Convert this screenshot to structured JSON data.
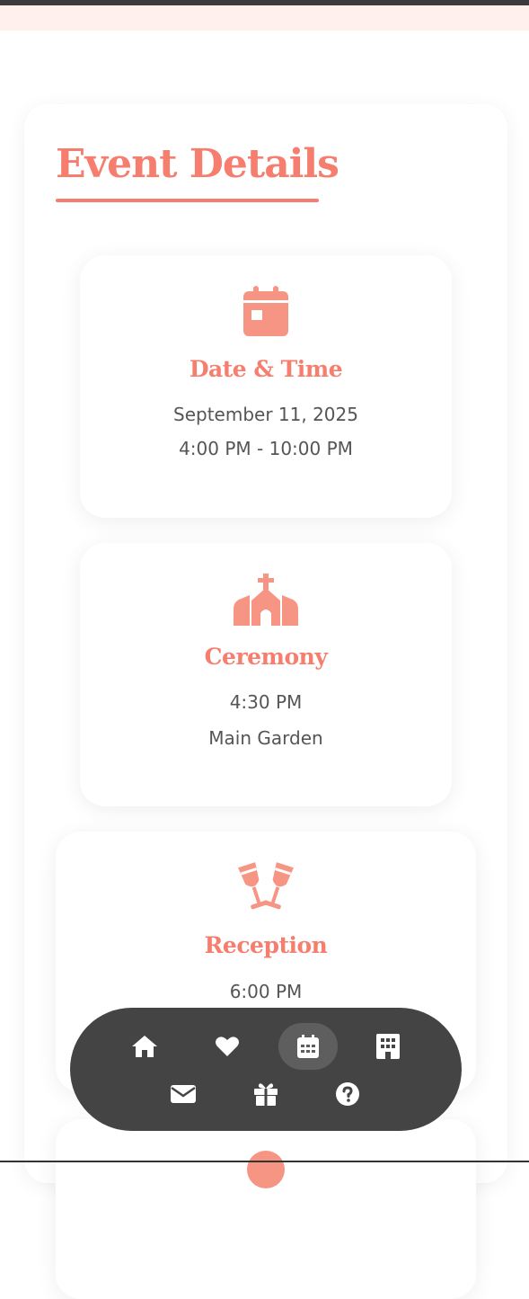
{
  "section": {
    "title": "Event Details"
  },
  "cards": [
    {
      "icon": "calendar-icon",
      "title": "Date & Time",
      "lines": [
        "September 11, 2025",
        "4:00 PM - 10:00 PM"
      ]
    },
    {
      "icon": "church-icon",
      "title": "Ceremony",
      "lines": [
        "4:30 PM",
        "Main Garden"
      ]
    },
    {
      "icon": "champagne-glasses-icon",
      "title": "Reception",
      "lines": [
        "6:00 PM"
      ]
    }
  ],
  "colors": {
    "accent": "#f67e6e",
    "icon": "#f79585",
    "text": "#555555",
    "nav_background": "#444444",
    "nav_active": "#5e5e5e"
  },
  "nav": {
    "items": [
      {
        "icon": "home-icon",
        "active": false
      },
      {
        "icon": "heart-icon",
        "active": false
      },
      {
        "icon": "calendar-icon",
        "active": true
      },
      {
        "icon": "hotel-icon",
        "active": false
      },
      {
        "icon": "envelope-icon",
        "active": false
      },
      {
        "icon": "gift-icon",
        "active": false
      },
      {
        "icon": "question-icon",
        "active": false
      }
    ]
  }
}
